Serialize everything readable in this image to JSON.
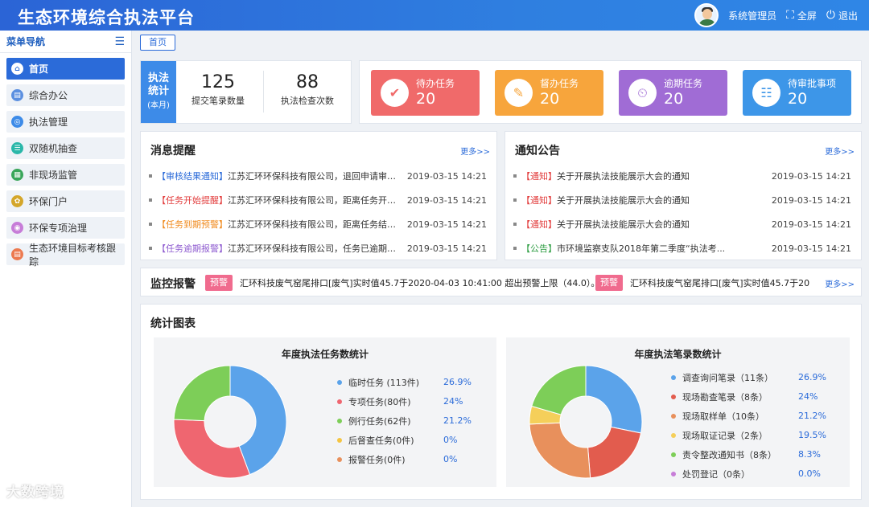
{
  "header": {
    "title": "生态环境综合执法平台",
    "user": "系统管理员",
    "fullscreen": "全屏",
    "logout": "退出"
  },
  "sidebar": {
    "title": "菜单导航",
    "items": [
      {
        "label": "首页",
        "icon": "home-icon",
        "color": "#2b6bd9"
      },
      {
        "label": "综合办公",
        "icon": "office-icon",
        "color": "#5b8fe0"
      },
      {
        "label": "执法管理",
        "icon": "target-icon",
        "color": "#3d8be8"
      },
      {
        "label": "双随机抽查",
        "icon": "list-icon",
        "color": "#2ab7a9"
      },
      {
        "label": "非现场监管",
        "icon": "monitor-icon",
        "color": "#3aa65a"
      },
      {
        "label": "环保门户",
        "icon": "portal-icon",
        "color": "#d4a62a"
      },
      {
        "label": "环保专项治理",
        "icon": "circle-icon",
        "color": "#c77dd8"
      },
      {
        "label": "生态环境目标考核跟踪",
        "icon": "track-icon",
        "color": "#ec7a50"
      }
    ]
  },
  "breadcrumb": "首页",
  "stats": {
    "tag_line1": "执法",
    "tag_line2": "统计",
    "tag_sub": "(本月)",
    "items": [
      {
        "value": "125",
        "label": "提交笔录数量"
      },
      {
        "value": "88",
        "label": "执法检查次数"
      }
    ]
  },
  "tasks": [
    {
      "label": "待办任务",
      "value": "20",
      "color": "#f06a6a",
      "icon": "calendar-check-icon"
    },
    {
      "label": "督办任务",
      "value": "20",
      "color": "#f7a53c",
      "icon": "clipboard-icon"
    },
    {
      "label": "逾期任务",
      "value": "20",
      "color": "#a06cd5",
      "icon": "calendar-clock-icon"
    },
    {
      "label": "待审批事项",
      "value": "20",
      "color": "#3d96e8",
      "icon": "document-user-icon"
    }
  ],
  "messages": {
    "title": "消息提醒",
    "more": "更多>>",
    "items": [
      {
        "tag": "【审核结果通知】",
        "tag_color": "#2b6bd9",
        "text": "江苏汇环环保科技有限公司，退回申请审核...",
        "time": "2019-03-15 14:21"
      },
      {
        "tag": "【任务开始提醒】",
        "tag_color": "#e23c3c",
        "text": "江苏汇环环保科技有限公司，距离任务开始...",
        "time": "2019-03-15 14:21"
      },
      {
        "tag": "【任务到期预警】",
        "tag_color": "#f08a1d",
        "text": "江苏汇环环保科技有限公司，距离任务结束...",
        "time": "2019-03-15 14:21"
      },
      {
        "tag": "【任务逾期报警】",
        "tag_color": "#8e5bd0",
        "text": "江苏汇环环保科技有限公司，任务已逾期2...",
        "time": "2019-03-15 14:21"
      }
    ]
  },
  "notices": {
    "title": "通知公告",
    "more": "更多>>",
    "items": [
      {
        "tag": "【通知】",
        "tag_color": "#e23c3c",
        "text": "关于开展执法技能展示大会的通知",
        "time": "2019-03-15 14:21"
      },
      {
        "tag": "【通知】",
        "tag_color": "#e23c3c",
        "text": "关于开展执法技能展示大会的通知",
        "time": "2019-03-15 14:21"
      },
      {
        "tag": "【通知】",
        "tag_color": "#e23c3c",
        "text": "关于开展执法技能展示大会的通知",
        "time": "2019-03-15 14:21"
      },
      {
        "tag": "【公告】",
        "tag_color": "#2f9e44",
        "text": "市环境监察支队2018年第二季度“执法考...",
        "time": "2019-03-15 14:21"
      }
    ]
  },
  "monitor": {
    "title": "监控报警",
    "badge": "预警",
    "text1": "汇环科技废气窑尾排口[废气]实时值45.7于2020-04-03 10:41:00 超出预警上限（44.0）。",
    "text2": "汇环科技废气窑尾排口[废气]实时值45.7于20",
    "more": "更多>>"
  },
  "charts_panel": {
    "title": "统计图表"
  },
  "chart_data": [
    {
      "type": "pie",
      "title": "年度执法任务数统计",
      "categories": [
        "临时任务 (113件)",
        "专项任务(80件)",
        "例行任务(62件)",
        "后督查任务(0件)",
        "报警任务(0件)"
      ],
      "values": [
        113,
        80,
        62,
        0,
        0
      ],
      "percent_labels": [
        "26.9%",
        "24%",
        "21.2%",
        "0%",
        "0%"
      ],
      "colors": [
        "#5ba3ea",
        "#ef6670",
        "#7dce58",
        "#f5c542",
        "#e8905c"
      ],
      "legend": "right"
    },
    {
      "type": "pie",
      "title": "年度执法笔录数统计",
      "categories": [
        "调查询问笔录（11条）",
        "现场勘查笔录（8条）",
        "现场取样单（10条）",
        "现场取证记录（2条）",
        "责令整改通知书（8条）",
        "处罚登记（0条）"
      ],
      "values": [
        11,
        8,
        10,
        2,
        8,
        0
      ],
      "percent_labels": [
        "26.9%",
        "24%",
        "21.2%",
        "19.5%",
        "8.3%",
        "0.0%"
      ],
      "colors": [
        "#5ba3ea",
        "#e25c4e",
        "#e8905c",
        "#f5cf5a",
        "#7dce58",
        "#c77dd8"
      ],
      "legend": "right"
    }
  ],
  "watermark": "大数跨境"
}
